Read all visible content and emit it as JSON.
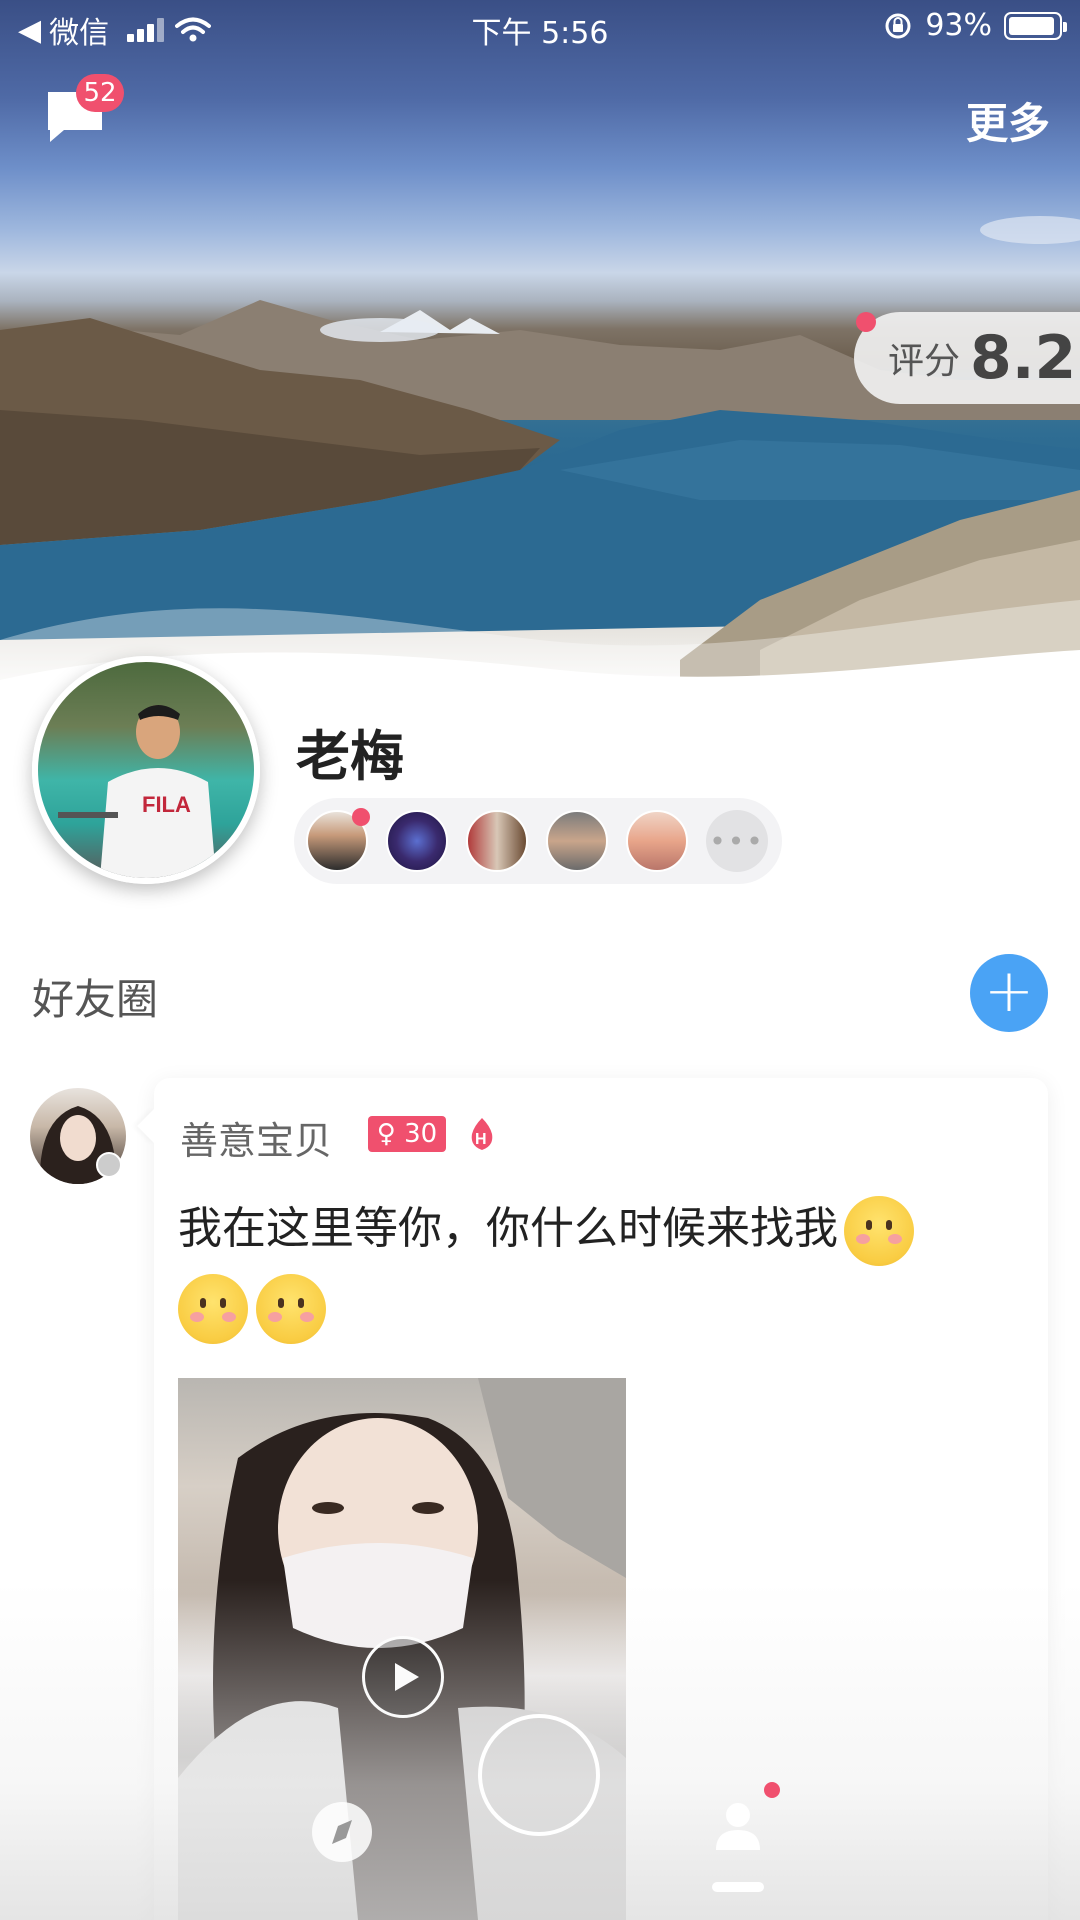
{
  "status_bar": {
    "back_app": "微信",
    "time": "下午 5:56",
    "battery": "93%"
  },
  "header": {
    "messages_badge": "52",
    "more_label": "更多"
  },
  "score": {
    "label": "评分",
    "value": "8.2"
  },
  "profile": {
    "name": "老梅"
  },
  "friends_strip": {
    "more_label": "•••"
  },
  "moments": {
    "title": "好友圈",
    "add_label": "+"
  },
  "post": {
    "user_name": "善意宝贝",
    "gender_age": "♀ 30",
    "text": "我在这里等你，你什么时候来找我"
  },
  "colors": {
    "accent_red": "#f0506e",
    "accent_blue": "#4aa3f5"
  }
}
